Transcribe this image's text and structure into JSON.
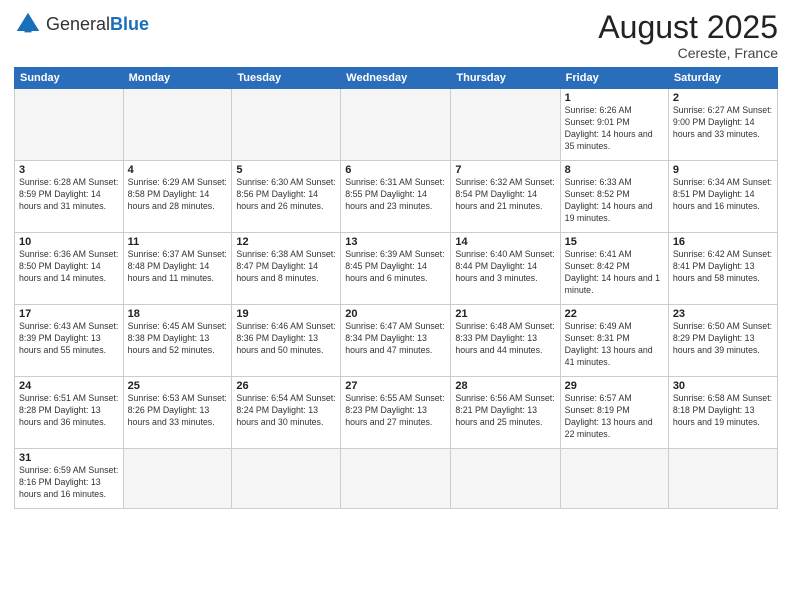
{
  "header": {
    "logo_general": "General",
    "logo_blue": "Blue",
    "title": "August 2025",
    "subtitle": "Cereste, France"
  },
  "days_of_week": [
    "Sunday",
    "Monday",
    "Tuesday",
    "Wednesday",
    "Thursday",
    "Friday",
    "Saturday"
  ],
  "weeks": [
    [
      {
        "num": "",
        "info": ""
      },
      {
        "num": "",
        "info": ""
      },
      {
        "num": "",
        "info": ""
      },
      {
        "num": "",
        "info": ""
      },
      {
        "num": "",
        "info": ""
      },
      {
        "num": "1",
        "info": "Sunrise: 6:26 AM\nSunset: 9:01 PM\nDaylight: 14 hours and 35 minutes."
      },
      {
        "num": "2",
        "info": "Sunrise: 6:27 AM\nSunset: 9:00 PM\nDaylight: 14 hours and 33 minutes."
      }
    ],
    [
      {
        "num": "3",
        "info": "Sunrise: 6:28 AM\nSunset: 8:59 PM\nDaylight: 14 hours and 31 minutes."
      },
      {
        "num": "4",
        "info": "Sunrise: 6:29 AM\nSunset: 8:58 PM\nDaylight: 14 hours and 28 minutes."
      },
      {
        "num": "5",
        "info": "Sunrise: 6:30 AM\nSunset: 8:56 PM\nDaylight: 14 hours and 26 minutes."
      },
      {
        "num": "6",
        "info": "Sunrise: 6:31 AM\nSunset: 8:55 PM\nDaylight: 14 hours and 23 minutes."
      },
      {
        "num": "7",
        "info": "Sunrise: 6:32 AM\nSunset: 8:54 PM\nDaylight: 14 hours and 21 minutes."
      },
      {
        "num": "8",
        "info": "Sunrise: 6:33 AM\nSunset: 8:52 PM\nDaylight: 14 hours and 19 minutes."
      },
      {
        "num": "9",
        "info": "Sunrise: 6:34 AM\nSunset: 8:51 PM\nDaylight: 14 hours and 16 minutes."
      }
    ],
    [
      {
        "num": "10",
        "info": "Sunrise: 6:36 AM\nSunset: 8:50 PM\nDaylight: 14 hours and 14 minutes."
      },
      {
        "num": "11",
        "info": "Sunrise: 6:37 AM\nSunset: 8:48 PM\nDaylight: 14 hours and 11 minutes."
      },
      {
        "num": "12",
        "info": "Sunrise: 6:38 AM\nSunset: 8:47 PM\nDaylight: 14 hours and 8 minutes."
      },
      {
        "num": "13",
        "info": "Sunrise: 6:39 AM\nSunset: 8:45 PM\nDaylight: 14 hours and 6 minutes."
      },
      {
        "num": "14",
        "info": "Sunrise: 6:40 AM\nSunset: 8:44 PM\nDaylight: 14 hours and 3 minutes."
      },
      {
        "num": "15",
        "info": "Sunrise: 6:41 AM\nSunset: 8:42 PM\nDaylight: 14 hours and 1 minute."
      },
      {
        "num": "16",
        "info": "Sunrise: 6:42 AM\nSunset: 8:41 PM\nDaylight: 13 hours and 58 minutes."
      }
    ],
    [
      {
        "num": "17",
        "info": "Sunrise: 6:43 AM\nSunset: 8:39 PM\nDaylight: 13 hours and 55 minutes."
      },
      {
        "num": "18",
        "info": "Sunrise: 6:45 AM\nSunset: 8:38 PM\nDaylight: 13 hours and 52 minutes."
      },
      {
        "num": "19",
        "info": "Sunrise: 6:46 AM\nSunset: 8:36 PM\nDaylight: 13 hours and 50 minutes."
      },
      {
        "num": "20",
        "info": "Sunrise: 6:47 AM\nSunset: 8:34 PM\nDaylight: 13 hours and 47 minutes."
      },
      {
        "num": "21",
        "info": "Sunrise: 6:48 AM\nSunset: 8:33 PM\nDaylight: 13 hours and 44 minutes."
      },
      {
        "num": "22",
        "info": "Sunrise: 6:49 AM\nSunset: 8:31 PM\nDaylight: 13 hours and 41 minutes."
      },
      {
        "num": "23",
        "info": "Sunrise: 6:50 AM\nSunset: 8:29 PM\nDaylight: 13 hours and 39 minutes."
      }
    ],
    [
      {
        "num": "24",
        "info": "Sunrise: 6:51 AM\nSunset: 8:28 PM\nDaylight: 13 hours and 36 minutes."
      },
      {
        "num": "25",
        "info": "Sunrise: 6:53 AM\nSunset: 8:26 PM\nDaylight: 13 hours and 33 minutes."
      },
      {
        "num": "26",
        "info": "Sunrise: 6:54 AM\nSunset: 8:24 PM\nDaylight: 13 hours and 30 minutes."
      },
      {
        "num": "27",
        "info": "Sunrise: 6:55 AM\nSunset: 8:23 PM\nDaylight: 13 hours and 27 minutes."
      },
      {
        "num": "28",
        "info": "Sunrise: 6:56 AM\nSunset: 8:21 PM\nDaylight: 13 hours and 25 minutes."
      },
      {
        "num": "29",
        "info": "Sunrise: 6:57 AM\nSunset: 8:19 PM\nDaylight: 13 hours and 22 minutes."
      },
      {
        "num": "30",
        "info": "Sunrise: 6:58 AM\nSunset: 8:18 PM\nDaylight: 13 hours and 19 minutes."
      }
    ],
    [
      {
        "num": "31",
        "info": "Sunrise: 6:59 AM\nSunset: 8:16 PM\nDaylight: 13 hours and 16 minutes."
      },
      {
        "num": "",
        "info": ""
      },
      {
        "num": "",
        "info": ""
      },
      {
        "num": "",
        "info": ""
      },
      {
        "num": "",
        "info": ""
      },
      {
        "num": "",
        "info": ""
      },
      {
        "num": "",
        "info": ""
      }
    ]
  ]
}
